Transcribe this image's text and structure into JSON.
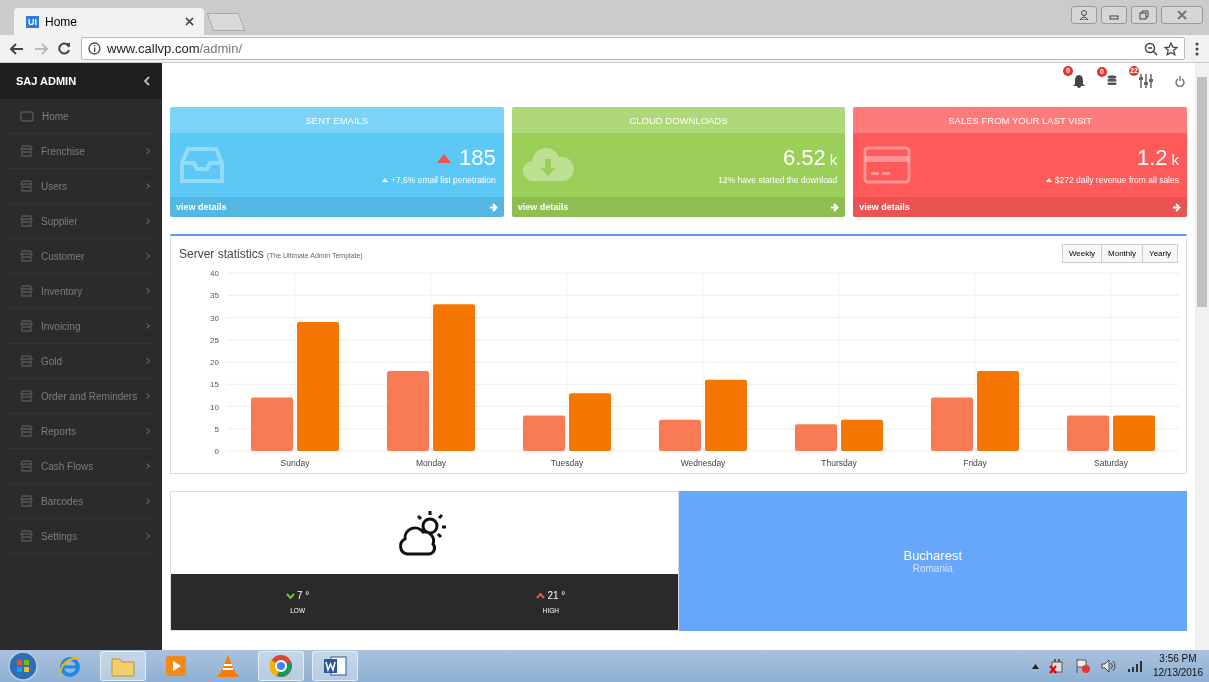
{
  "browser": {
    "tab": {
      "favicon_text": "UI",
      "title": "Home"
    },
    "url_host": "www.callvp.com",
    "url_path": "/admin/"
  },
  "sidebar": {
    "title": "SAJ ADMIN",
    "items": [
      {
        "label": "Home",
        "expandable": false
      },
      {
        "label": "Frenchise",
        "expandable": true
      },
      {
        "label": "Users",
        "expandable": true
      },
      {
        "label": "Supplier",
        "expandable": true
      },
      {
        "label": "Customer",
        "expandable": true
      },
      {
        "label": "Inventory",
        "expandable": true
      },
      {
        "label": "Invoicing",
        "expandable": true
      },
      {
        "label": "Gold",
        "expandable": true
      },
      {
        "label": "Order and Reminders",
        "expandable": true
      },
      {
        "label": "Reports",
        "expandable": true
      },
      {
        "label": "Cash Flows",
        "expandable": true
      },
      {
        "label": "Barcodes",
        "expandable": true
      },
      {
        "label": "Settings",
        "expandable": true
      }
    ]
  },
  "topbar": {
    "badges": [
      "0",
      "0",
      "22"
    ]
  },
  "cards": [
    {
      "title": "SENT EMAILS",
      "value": "185",
      "trend_up": true,
      "sub_arrow": true,
      "subtitle": "+7,6% email list penetration",
      "link": "view details",
      "color": "#5bc8f5"
    },
    {
      "title": "CLOUD DOWNLOADS",
      "value": "6.52",
      "unit": "k",
      "trend_up": false,
      "sub_arrow": false,
      "subtitle": "12% have started the download",
      "link": "view details",
      "color": "#9bcf5a"
    },
    {
      "title": "SALES FROM YOUR LAST VISIT",
      "value": "1.2",
      "unit": "k",
      "trend_up": false,
      "sub_arrow": true,
      "subtitle": "$272 daily revenue from all sales",
      "link": "view details",
      "color": "#ff5a5a"
    }
  ],
  "stats": {
    "title": "Server statistics",
    "subtitle": "(The Ultimate Admin Template)",
    "periods": [
      "Weekly",
      "Monthly",
      "Yearly"
    ],
    "chart_data": {
      "type": "bar",
      "grid": true,
      "categories": [
        "Sunday",
        "Monday",
        "Tuesday",
        "Wednesday",
        "Thursday",
        "Friday",
        "Saturday"
      ],
      "ylim": [
        0,
        40
      ],
      "yticks": [
        0,
        5,
        10,
        15,
        20,
        25,
        30,
        35,
        40
      ],
      "series": [
        {
          "color": "#f87b56",
          "values": [
            12,
            18,
            8,
            7,
            6,
            12,
            8
          ]
        },
        {
          "color": "#f57600",
          "values": [
            29,
            33,
            13,
            16,
            7,
            18,
            8
          ]
        }
      ]
    }
  },
  "weather": {
    "low": "7 °",
    "low_label": "LOW",
    "high": "21 °",
    "high_label": "HIGH",
    "city": "Bucharest",
    "country": "Romania"
  },
  "taskbar": {
    "time": "3:56 PM",
    "date": "12/13/2016"
  }
}
